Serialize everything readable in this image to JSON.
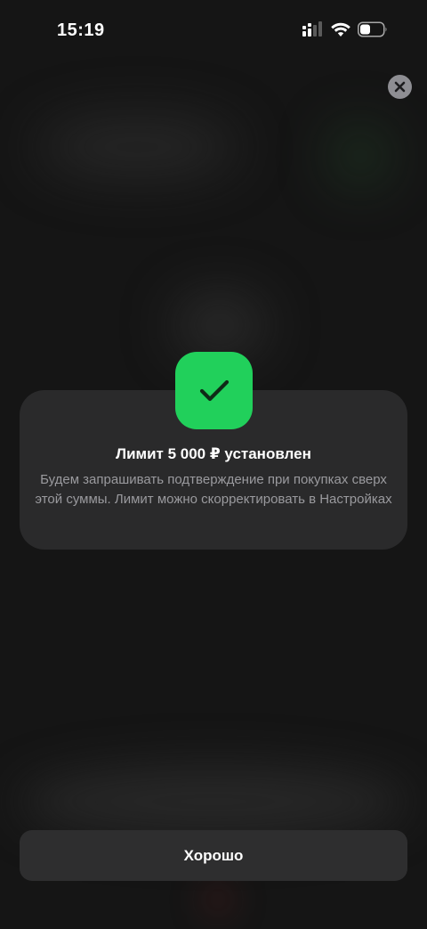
{
  "status_bar": {
    "time": "15:19",
    "icons": [
      "signal-icon",
      "wifi-icon",
      "battery-icon"
    ]
  },
  "close": {
    "icon": "close-icon"
  },
  "dialog": {
    "icon": "checkmark-icon",
    "title": "Лимит 5 000 ₽ установлен",
    "text": "Будем запрашивать подтверждение при покупках сверх этой суммы. Лимит можно скорректировать в Настройках"
  },
  "actions": {
    "ok_label": "Хорошо"
  },
  "colors": {
    "background": "#151515",
    "card": "#2a2a2b",
    "accent_green": "#21d05b",
    "secondary_text": "#9a9a9e",
    "button": "#2e2e2f"
  }
}
